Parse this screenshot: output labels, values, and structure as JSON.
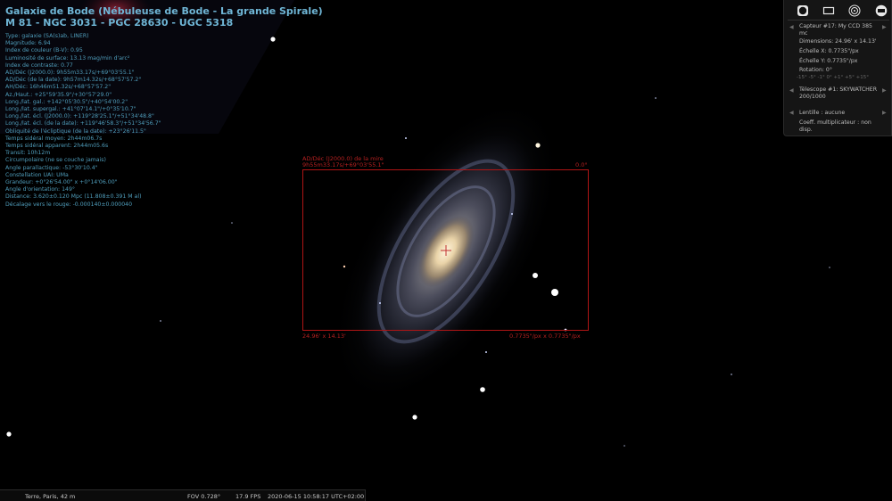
{
  "object": {
    "title_line1": "Galaxie de Bode (Nébuleuse de Bode - La grande Spirale)",
    "title_line2": "M 81 - NGC 3031 - PGC 28630 - UGC 5318",
    "info_lines": [
      "Type: galaxie (SA(s)ab, LINER)",
      "Magnitude: 6.94",
      "Index de couleur (B-V): 0.95",
      "Luminosité de surface: 13.13 mag/min d'arc²",
      "Index de contraste: 0.77",
      "AD/Déc (J2000.0): 9h55m33.17s/+69°03'55.1\"",
      "AD/Déc (de la date): 9h57m14.32s/+68°57'57.2\"",
      "AH/Déc: 16h46m51.32s/+68°57'57.2\"",
      "Az./Haut.: +25°59'35.9\"/+30°57'29.0\"",
      "Long./lat. gal.: +142°05'30.5\"/+40°54'00.2\"",
      "Long./lat. supergal.: +41°07'14.1\"/+0°35'10.7\"",
      "Long./lat. écl. (J2000.0): +119°28'25.1\"/+51°34'48.8\"",
      "Long./lat. écl. (de la date): +119°46'58.3\"/+51°34'56.7\"",
      "Obliquité de l'écliptique (de la date): +23°26'11.5\"",
      "Temps sidéral moyen: 2h44m06.7s",
      "Temps sidéral apparent: 2h44m05.6s",
      "Transit: 10h12m",
      "Circumpolaire (ne se couche jamais)",
      "Angle parallactique: -53°30'10.4\"",
      "Constellation UAI: UMa",
      "Grandeur: +0°26'54.00\" x +0°14'06.00\"",
      "Angle d'orientation: 149°",
      "Distance: 3.620±0.120 Mpc (11.808±0.391 M al)",
      "Décalage vers le rouge: -0.000140±0.000040"
    ]
  },
  "frame": {
    "label_top1": "AD/Déc (J2000.0) de la mire",
    "label_top2": "9h55m33.17s/+69°03'55.1\"",
    "rotation": "0.0°",
    "size": "24.96' x 14.13'",
    "scale": "0.7735\"/px x 0.7735\"/px"
  },
  "ocular_panel": {
    "sensor": "Capteur #17: My CCD 385 mc",
    "dimensions": "Dimensions: 24.96' x 14.13'",
    "scale_x": "Échelle X: 0.7735\"/px",
    "scale_y": "Échelle Y: 0.7735\"/px",
    "rotation": "Rotation: 0°",
    "rotation_steps": "-15° -5° -1° 0° +1° +5° +15°",
    "telescope": "Télescope #1: SKYWATCHER 200/1000",
    "lens": "Lentille : aucune",
    "multiplier": "Coeff. multiplicateur : non disp."
  },
  "status": {
    "location": "Terre, Paris, 42 m",
    "fov": "FOV 0.728°",
    "fps": "17.9 FPS",
    "datetime": "2020-06-15 10:58:17 UTC+02:00"
  },
  "colors": {
    "info_text": "#5aa9c8",
    "frame": "#b01515",
    "panel_bg": "#151515"
  }
}
